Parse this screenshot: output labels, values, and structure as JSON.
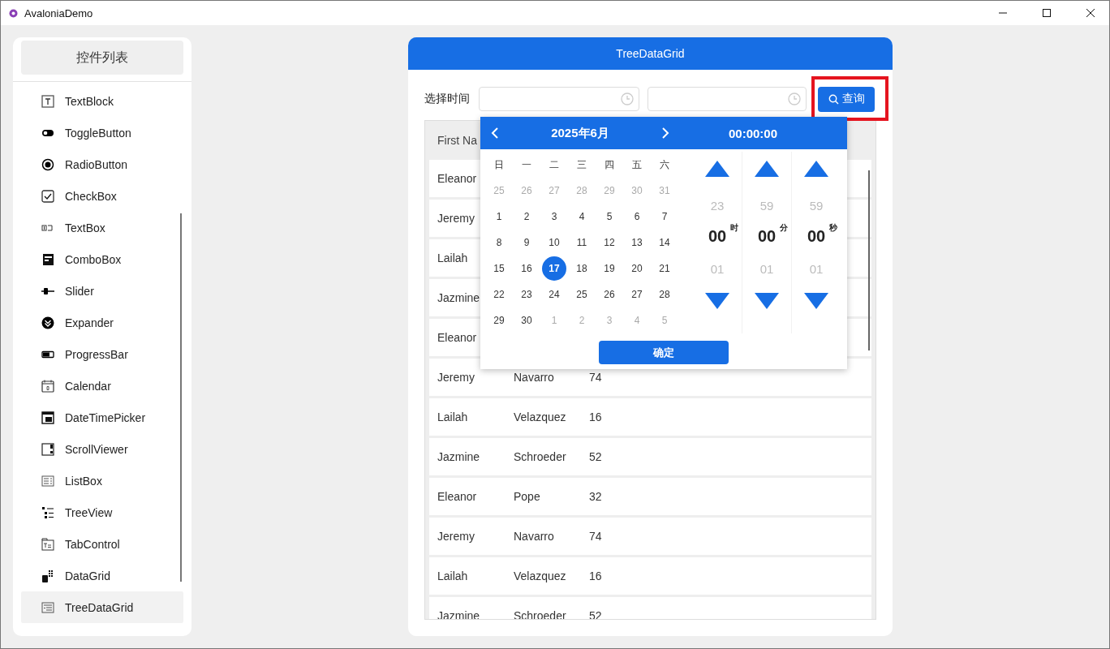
{
  "window": {
    "title": "AvaloniaDemo"
  },
  "sidebar": {
    "title": "控件列表",
    "items": [
      {
        "label": "TextBlock",
        "selected": false
      },
      {
        "label": "ToggleButton",
        "selected": false
      },
      {
        "label": "RadioButton",
        "selected": false
      },
      {
        "label": "CheckBox",
        "selected": false
      },
      {
        "label": "TextBox",
        "selected": false
      },
      {
        "label": "ComboBox",
        "selected": false
      },
      {
        "label": "Slider",
        "selected": false
      },
      {
        "label": "Expander",
        "selected": false
      },
      {
        "label": "ProgressBar",
        "selected": false
      },
      {
        "label": "Calendar",
        "selected": false
      },
      {
        "label": "DateTimePicker",
        "selected": false
      },
      {
        "label": "ScrollViewer",
        "selected": false
      },
      {
        "label": "ListBox",
        "selected": false
      },
      {
        "label": "TreeView",
        "selected": false
      },
      {
        "label": "TabControl",
        "selected": false
      },
      {
        "label": "DataGrid",
        "selected": false
      },
      {
        "label": "TreeDataGrid",
        "selected": true
      }
    ]
  },
  "main": {
    "title": "TreeDataGrid",
    "filter": {
      "label": "选择时间",
      "query_button": "查询",
      "query_highlighted": true
    },
    "table": {
      "header": "First Na",
      "rows": [
        {
          "cells": [
            "Eleanor"
          ]
        },
        {
          "cells": [
            "Jeremy"
          ]
        },
        {
          "cells": [
            "Lailah"
          ]
        },
        {
          "cells": [
            "Jazmine"
          ]
        },
        {
          "cells": [
            "Eleanor"
          ]
        },
        {
          "cells": [
            "Jeremy",
            "Navarro",
            "74"
          ]
        },
        {
          "cells": [
            "Lailah",
            "Velazquez",
            "16"
          ]
        },
        {
          "cells": [
            "Jazmine",
            "Schroeder",
            "52"
          ]
        },
        {
          "cells": [
            "Eleanor",
            "Pope",
            "32"
          ]
        },
        {
          "cells": [
            "Jeremy",
            "Navarro",
            "74"
          ]
        },
        {
          "cells": [
            "Lailah",
            "Velazquez",
            "16"
          ]
        },
        {
          "cells": [
            "Jazmine",
            "Schroeder",
            "52"
          ]
        }
      ]
    },
    "picker": {
      "month": "2025年6月",
      "time": "00:00:00",
      "weekdays": [
        "日",
        "一",
        "二",
        "三",
        "四",
        "五",
        "六"
      ],
      "days": [
        {
          "label": "25",
          "muted": true,
          "selected": false
        },
        {
          "label": "26",
          "muted": true,
          "selected": false
        },
        {
          "label": "27",
          "muted": true,
          "selected": false
        },
        {
          "label": "28",
          "muted": true,
          "selected": false
        },
        {
          "label": "29",
          "muted": true,
          "selected": false
        },
        {
          "label": "30",
          "muted": true,
          "selected": false
        },
        {
          "label": "31",
          "muted": true,
          "selected": false
        },
        {
          "label": "1",
          "muted": false,
          "selected": false
        },
        {
          "label": "2",
          "muted": false,
          "selected": false
        },
        {
          "label": "3",
          "muted": false,
          "selected": false
        },
        {
          "label": "4",
          "muted": false,
          "selected": false
        },
        {
          "label": "5",
          "muted": false,
          "selected": false
        },
        {
          "label": "6",
          "muted": false,
          "selected": false
        },
        {
          "label": "7",
          "muted": false,
          "selected": false
        },
        {
          "label": "8",
          "muted": false,
          "selected": false
        },
        {
          "label": "9",
          "muted": false,
          "selected": false
        },
        {
          "label": "10",
          "muted": false,
          "selected": false
        },
        {
          "label": "11",
          "muted": false,
          "selected": false
        },
        {
          "label": "12",
          "muted": false,
          "selected": false
        },
        {
          "label": "13",
          "muted": false,
          "selected": false
        },
        {
          "label": "14",
          "muted": false,
          "selected": false
        },
        {
          "label": "15",
          "muted": false,
          "selected": false
        },
        {
          "label": "16",
          "muted": false,
          "selected": false
        },
        {
          "label": "17",
          "muted": false,
          "selected": true
        },
        {
          "label": "18",
          "muted": false,
          "selected": false
        },
        {
          "label": "19",
          "muted": false,
          "selected": false
        },
        {
          "label": "20",
          "muted": false,
          "selected": false
        },
        {
          "label": "21",
          "muted": false,
          "selected": false
        },
        {
          "label": "22",
          "muted": false,
          "selected": false
        },
        {
          "label": "23",
          "muted": false,
          "selected": false
        },
        {
          "label": "24",
          "muted": false,
          "selected": false
        },
        {
          "label": "25",
          "muted": false,
          "selected": false
        },
        {
          "label": "26",
          "muted": false,
          "selected": false
        },
        {
          "label": "27",
          "muted": false,
          "selected": false
        },
        {
          "label": "28",
          "muted": false,
          "selected": false
        },
        {
          "label": "29",
          "muted": false,
          "selected": false
        },
        {
          "label": "30",
          "muted": false,
          "selected": false
        },
        {
          "label": "1",
          "muted": true,
          "selected": false
        },
        {
          "label": "2",
          "muted": true,
          "selected": false
        },
        {
          "label": "3",
          "muted": true,
          "selected": false
        },
        {
          "label": "4",
          "muted": true,
          "selected": false
        },
        {
          "label": "5",
          "muted": true,
          "selected": false
        }
      ],
      "spinners": [
        {
          "prev": "23",
          "value": "00",
          "unit": "时",
          "next": "01"
        },
        {
          "prev": "59",
          "value": "00",
          "unit": "分",
          "next": "01"
        },
        {
          "prev": "59",
          "value": "00",
          "unit": "秒",
          "next": "01"
        }
      ],
      "confirm": "确定"
    }
  }
}
